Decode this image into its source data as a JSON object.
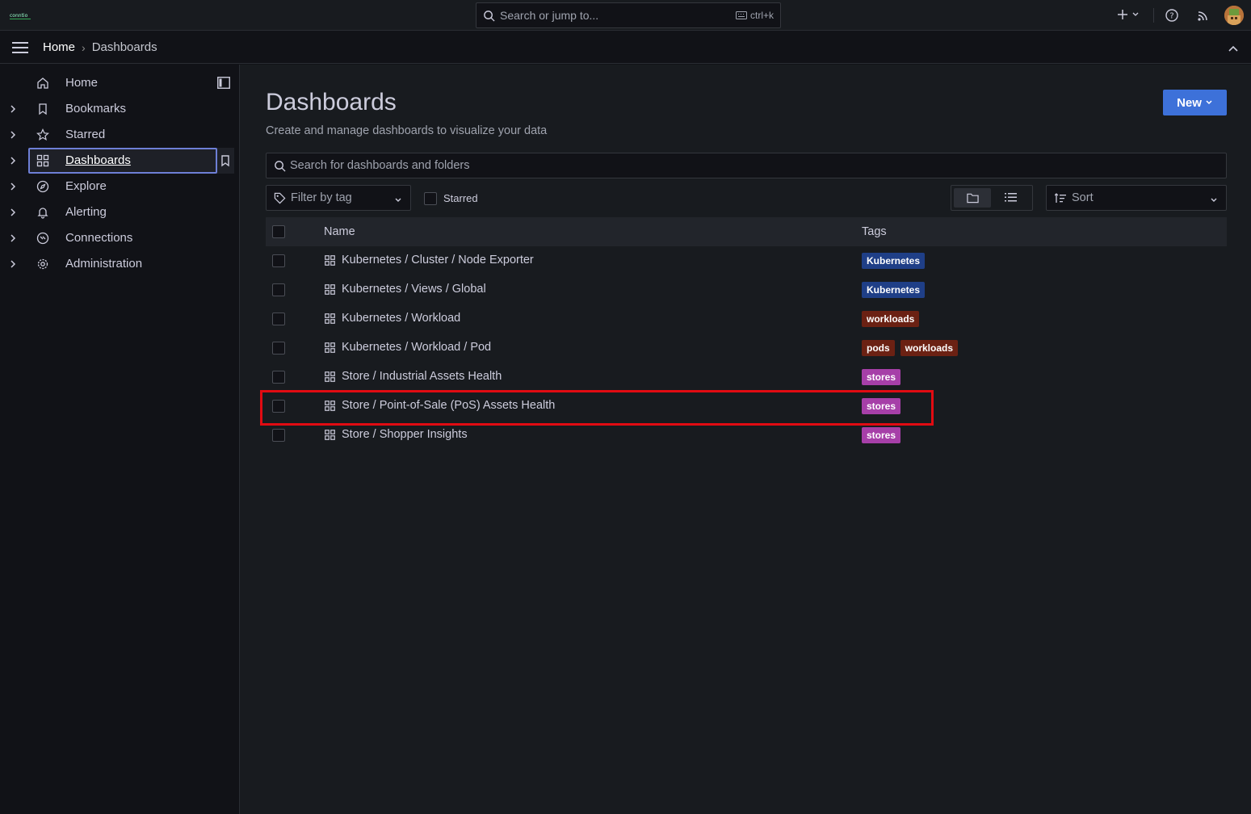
{
  "topbar": {
    "search_placeholder": "Search or jump to...",
    "shortcut": "ctrl+k"
  },
  "breadcrumb": {
    "home": "Home",
    "separator": "›",
    "current": "Dashboards"
  },
  "sidebar": {
    "items": [
      {
        "label": "Home",
        "icon": "home-icon",
        "expandable": false
      },
      {
        "label": "Bookmarks",
        "icon": "bookmark-icon",
        "expandable": true
      },
      {
        "label": "Starred",
        "icon": "star-icon",
        "expandable": true
      },
      {
        "label": "Dashboards",
        "icon": "apps-icon",
        "expandable": true,
        "active": true
      },
      {
        "label": "Explore",
        "icon": "compass-icon",
        "expandable": true
      },
      {
        "label": "Alerting",
        "icon": "bell-icon",
        "expandable": true
      },
      {
        "label": "Connections",
        "icon": "connections-icon",
        "expandable": true
      },
      {
        "label": "Administration",
        "icon": "cog-icon",
        "expandable": true
      }
    ]
  },
  "page": {
    "title": "Dashboards",
    "subtitle": "Create and manage dashboards to visualize your data",
    "new_button": "New"
  },
  "filters": {
    "search_placeholder": "Search for dashboards and folders",
    "tag_placeholder": "Filter by tag",
    "starred_label": "Starred",
    "sort_placeholder": "Sort"
  },
  "table": {
    "columns": [
      "Name",
      "Tags"
    ],
    "rows": [
      {
        "name": "Kubernetes / Cluster / Node Exporter",
        "tags": [
          "Kubernetes"
        ]
      },
      {
        "name": "Kubernetes / Views / Global",
        "tags": [
          "Kubernetes"
        ]
      },
      {
        "name": "Kubernetes / Workload",
        "tags": [
          "workloads"
        ]
      },
      {
        "name": "Kubernetes / Workload / Pod",
        "tags": [
          "pods",
          "workloads"
        ]
      },
      {
        "name": "Store / Industrial Assets Health",
        "tags": [
          "stores"
        ]
      },
      {
        "name": "Store / Point-of-Sale (PoS) Assets Health",
        "tags": [
          "stores"
        ]
      },
      {
        "name": "Store / Shopper Insights",
        "tags": [
          "stores"
        ]
      }
    ]
  },
  "colors": {
    "accent": "#3d71d9",
    "highlight": "#e10b12",
    "tag_kubernetes": "#1f3f87",
    "tag_workloads": "#6b2113",
    "tag_pods": "#6b2113",
    "tag_stores": "#a63fa8"
  }
}
